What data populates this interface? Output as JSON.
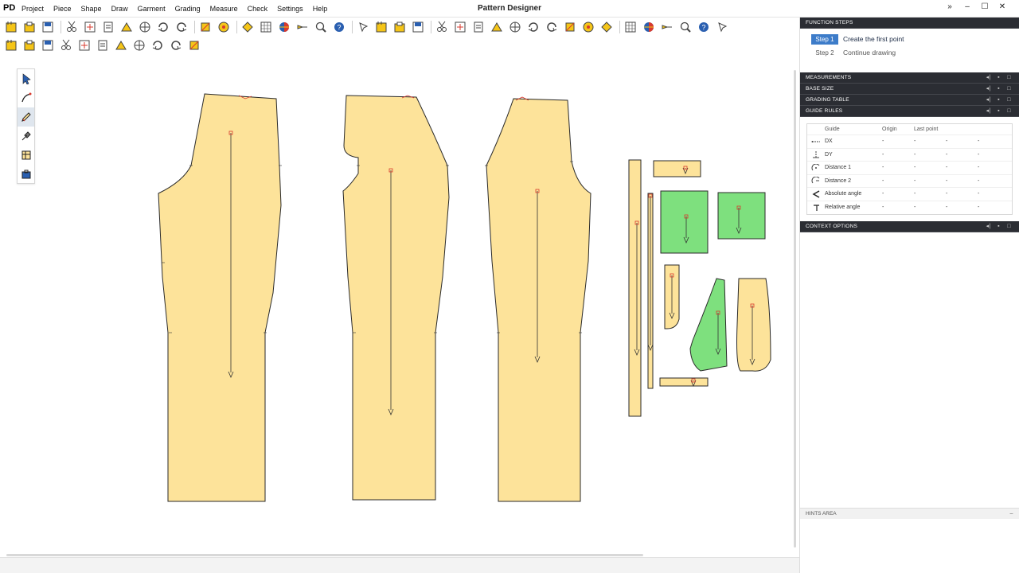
{
  "app": {
    "logo": "PD",
    "title": "Pattern Designer",
    "menu": [
      "Project",
      "Piece",
      "Shape",
      "Draw",
      "Garment",
      "Grading",
      "Measure",
      "Check",
      "Settings",
      "Help"
    ],
    "window_controls": [
      "»",
      "–",
      "☐",
      "✕"
    ]
  },
  "toolbar_top": {
    "icons": [
      "new-project-icon",
      "open-project-icon",
      "save-icon",
      "cut-icon",
      "export-icon",
      "scissors-icon",
      "copy-piece-icon",
      "paste-piece-icon",
      "print-icon",
      "plot-icon",
      "undo-icon",
      "redo-icon",
      "piece-icon",
      "piece-menu-icon",
      "piece-group-icon",
      "piece-add-icon",
      "color-icon",
      "grid-icon",
      "arrow-tool-icon",
      "layout-icon",
      "table-icon",
      "folder-icon",
      "zoom-window-icon",
      "zoom-icon",
      "zoom-fit-icon",
      "zoom-in-icon",
      "zoom-out-icon",
      "zoom-all-icon",
      "snapshot-icon",
      "measure-icon",
      "measure-add-icon",
      "car-icon",
      "help-icon",
      "notch-icon",
      "mirror-icon",
      "delete-point-icon",
      "layer-icon",
      "visibility-icon"
    ]
  },
  "toolbar_second": {
    "icons": [
      "select-point-icon",
      "select-box-icon",
      "ellipse-icon",
      "curve-icon",
      "rotate-icon",
      "refresh-icon",
      "target-icon",
      "circle-icon",
      "square-icon",
      "diamond-icon",
      "pin-icon"
    ]
  },
  "palette": {
    "tools": [
      "pointer-icon",
      "curve-tool-icon",
      "draw-tool-icon",
      "knife-tool-icon",
      "grid-tool-icon",
      "briefcase-tool-icon"
    ],
    "active_index": 2
  },
  "panel": {
    "function_steps_title": "FUNCTION STEPS",
    "steps": [
      {
        "num": "Step 1",
        "text": "Create the first point",
        "active": true
      },
      {
        "num": "Step 2",
        "text": "Continue drawing",
        "active": false
      }
    ],
    "sections": [
      "MEASUREMENTS",
      "BASE SIZE",
      "GRADING TABLE",
      "GUIDE RULES"
    ],
    "guide_table": {
      "headers": [
        "Guide",
        "Origin",
        "Last point",
        "",
        ""
      ],
      "rows": [
        {
          "icon": "dx-icon",
          "name": "DX",
          "origin": "-",
          "last": "-",
          "c4": "-",
          "c5": "-"
        },
        {
          "icon": "dy-icon",
          "name": "DY",
          "origin": "-",
          "last": "-",
          "c4": "-",
          "c5": "-"
        },
        {
          "icon": "distance1-icon",
          "name": "Distance 1",
          "origin": "-",
          "last": "-",
          "c4": "-",
          "c5": "-"
        },
        {
          "icon": "distance2-icon",
          "name": "Distance 2",
          "origin": "-",
          "last": "-",
          "c4": "-",
          "c5": "-"
        },
        {
          "icon": "absolute-angle-icon",
          "name": "Absolute angle",
          "origin": "-",
          "last": "-",
          "c4": "-",
          "c5": "-"
        },
        {
          "icon": "relative-angle-icon",
          "name": "Relative angle",
          "origin": "-",
          "last": "-",
          "c4": "-",
          "c5": "-"
        }
      ]
    },
    "context_options": "CONTEXT OPTIONS",
    "hints_area": "HINTS AREA",
    "section_controls": [
      "◂|",
      "▪",
      "□"
    ]
  },
  "colors": {
    "piece_fill": "#fde39a",
    "piece_fill_green": "#7ee07e",
    "piece_stroke": "#2a2a2a",
    "accent_red": "#d83a2e",
    "panel_dark": "#2b2d33",
    "step_active": "#3d7cc9"
  },
  "pieces": [
    "front-trouser-left-piece",
    "back-trouser-piece",
    "front-trouser-right-piece",
    "waistband-piece",
    "belt-loop-piece",
    "small-rect-top-piece",
    "pocket-bag-green-piece",
    "pocket-bag-green-piece-2",
    "small-facing-piece",
    "pocket-green-angled-piece",
    "pocket-facing-piece",
    "small-strip-piece"
  ]
}
